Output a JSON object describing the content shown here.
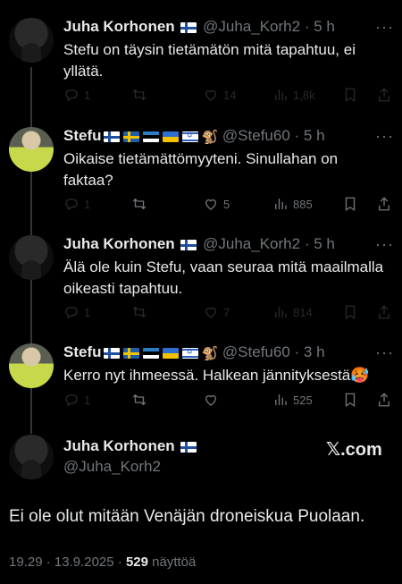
{
  "tweets": [
    {
      "name": "Juha Korhonen",
      "flags": [
        "fi"
      ],
      "handle": "@Juha_Korh2",
      "time": "5 h",
      "text": "Stefu on täysin tietämätön mitä tapahtuu, ei yllätä.",
      "replies": "1",
      "likes": "14",
      "views": "1,8k",
      "dim": true
    },
    {
      "name": "Stefu",
      "flags": [
        "fi",
        "se",
        "ee",
        "ua",
        "il",
        "monkey"
      ],
      "handle": "@Stefu60",
      "time": "5 h",
      "text": "Oikaise tietämättömyyteni. Sinullahan on faktaa?",
      "replies": "1",
      "likes": "5",
      "views": "885",
      "dim": false
    },
    {
      "name": "Juha Korhonen",
      "flags": [
        "fi"
      ],
      "handle": "@Juha_Korh2",
      "time": "5 h",
      "text": "Älä ole kuin Stefu, vaan seuraa mitä maailmalla oikeasti tapahtuu.",
      "replies": "1",
      "likes": "7",
      "views": "814",
      "dim": true
    },
    {
      "name": "Stefu",
      "flags": [
        "fi",
        "se",
        "ee",
        "ua",
        "il",
        "monkey"
      ],
      "handle": "@Stefu60",
      "time": "3 h",
      "text": "Kerro nyt ihmeessä. Halkean jännityksestä🥵",
      "replies": "1",
      "likes": "",
      "views": "525",
      "dim": false
    }
  ],
  "main": {
    "name": "Juha Korhonen",
    "handle": "@Juha_Korh2",
    "brand": "𝕏.com",
    "text": "Ei ole olut mitään Venäjän droneiskua Puolaan.",
    "timestamp": "19.29 · 13.9.2025 · ",
    "views_count": "529",
    "views_label": " näyttöä"
  },
  "separator": " · ",
  "more_glyph": "···",
  "colors": {
    "background": "#000000",
    "text": "#e7e9ea",
    "muted": "#71767b",
    "thread_line": "#333639"
  }
}
